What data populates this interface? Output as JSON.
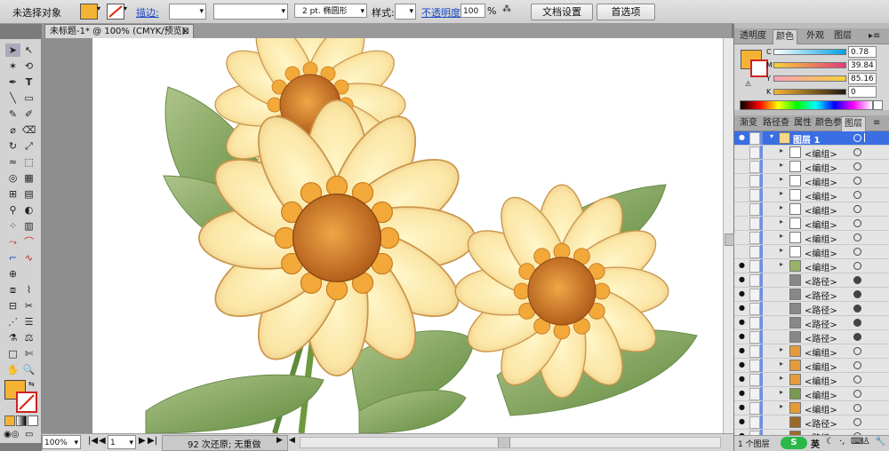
{
  "control": {
    "selection": "未选择对象",
    "stroke_label": "描边:",
    "stroke_profile": "2 pt. 椭圆形",
    "style_label": "样式:",
    "opacity_label": "不透明度:",
    "opacity_value": "100",
    "opacity_unit": "%",
    "doc_setup": "文档设置",
    "preferences": "首选项",
    "fill_color": "#f5b335"
  },
  "doc": {
    "tab_title": "未标题-1* @ 100% (CMYK/预览)",
    "tab_close": "⊠"
  },
  "status": {
    "zoom": "100%",
    "page": "1",
    "history": "92 次还原; 无重做"
  },
  "tools": {
    "fill_color": "#f5b335"
  },
  "color_panel": {
    "tabs": [
      "透明度",
      "颜色",
      "外观",
      "图层"
    ],
    "active_tab": "颜色",
    "swatch": "#f5b335",
    "channels": [
      {
        "label": "C",
        "value": "0.78"
      },
      {
        "label": "M",
        "value": "39.84"
      },
      {
        "label": "Y",
        "value": "85.16"
      },
      {
        "label": "K",
        "value": "0"
      }
    ]
  },
  "layers_panel": {
    "tabs": [
      "渐变",
      "路径查",
      "属性",
      "颜色参",
      "图层"
    ],
    "active_tab": "图层",
    "layer_name": "图层 1",
    "rows": [
      {
        "name": "<编组>",
        "visible": false,
        "expand": true,
        "thumb": "#ffffff",
        "filled": false
      },
      {
        "name": "<编组>",
        "visible": false,
        "expand": true,
        "thumb": "#ffffff",
        "filled": false
      },
      {
        "name": "<编组>",
        "visible": false,
        "expand": true,
        "thumb": "#ffffff",
        "filled": false
      },
      {
        "name": "<编组>",
        "visible": false,
        "expand": true,
        "thumb": "#ffffff",
        "filled": false
      },
      {
        "name": "<编组>",
        "visible": false,
        "expand": true,
        "thumb": "#ffffff",
        "filled": false
      },
      {
        "name": "<编组>",
        "visible": false,
        "expand": true,
        "thumb": "#ffffff",
        "filled": false
      },
      {
        "name": "<编组>",
        "visible": false,
        "expand": true,
        "thumb": "#ffffff",
        "filled": false
      },
      {
        "name": "<编组>",
        "visible": false,
        "expand": true,
        "thumb": "#ffffff",
        "filled": false
      },
      {
        "name": "<编组>",
        "visible": true,
        "expand": true,
        "thumb": "#9ab36a",
        "filled": false
      },
      {
        "name": "<路径>",
        "visible": true,
        "expand": false,
        "thumb": "#888888",
        "filled": true
      },
      {
        "name": "<路径>",
        "visible": true,
        "expand": false,
        "thumb": "#888888",
        "filled": true
      },
      {
        "name": "<路径>",
        "visible": true,
        "expand": false,
        "thumb": "#888888",
        "filled": true
      },
      {
        "name": "<路径>",
        "visible": true,
        "expand": false,
        "thumb": "#888888",
        "filled": true
      },
      {
        "name": "<路径>",
        "visible": true,
        "expand": false,
        "thumb": "#888888",
        "filled": true
      },
      {
        "name": "<编组>",
        "visible": true,
        "expand": true,
        "thumb": "#e39b3a",
        "filled": false
      },
      {
        "name": "<编组>",
        "visible": true,
        "expand": true,
        "thumb": "#e39b3a",
        "filled": false
      },
      {
        "name": "<编组>",
        "visible": true,
        "expand": true,
        "thumb": "#e39b3a",
        "filled": false
      },
      {
        "name": "<编组>",
        "visible": true,
        "expand": true,
        "thumb": "#7a9a50",
        "filled": false
      },
      {
        "name": "<编组>",
        "visible": true,
        "expand": true,
        "thumb": "#e39b3a",
        "filled": false
      },
      {
        "name": "<路径>",
        "visible": true,
        "expand": false,
        "thumb": "#9a6a2a",
        "filled": false
      },
      {
        "name": "<路径>",
        "visible": true,
        "expand": false,
        "thumb": "#9a6a2a",
        "filled": false
      }
    ],
    "footer": "1 个图层"
  }
}
